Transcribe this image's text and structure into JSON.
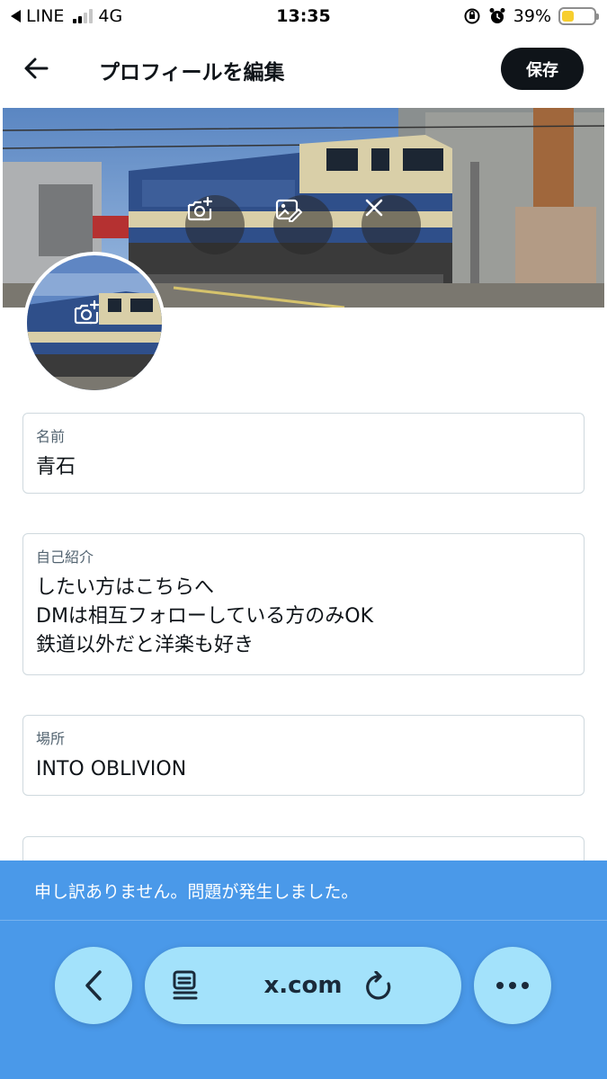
{
  "status_bar": {
    "carrier_back": "LINE",
    "network": "4G",
    "time": "13:35",
    "battery_percent": "39%",
    "signal_bars_active": 2
  },
  "header": {
    "title": "プロフィールを編集",
    "save_label": "保存",
    "back_icon": "arrow-left-icon"
  },
  "banner": {
    "icons": [
      "camera-plus-icon",
      "image-edit-icon",
      "close-icon"
    ]
  },
  "avatar": {
    "icon": "camera-plus-icon"
  },
  "form": {
    "name": {
      "label": "名前",
      "value": "青石"
    },
    "bio": {
      "label": "自己紹介",
      "value": "したい方はこちらへ\nDMは相互フォローしている方のみOK\n鉄道以外だと洋楽も好き"
    },
    "location": {
      "label": "場所",
      "value": "INTO OBLIVION"
    }
  },
  "error": {
    "message": "申し訳ありません。問題が発生しました。"
  },
  "browser": {
    "url": "x.com",
    "icons": [
      "chevron-left-icon",
      "reader-icon",
      "reload-icon",
      "more-icon"
    ]
  },
  "colors": {
    "accent_dark": "#0f1419",
    "error_bg": "#4a99e9",
    "pill_bg": "#a3e2fb",
    "battery": "#f7ce2e"
  }
}
